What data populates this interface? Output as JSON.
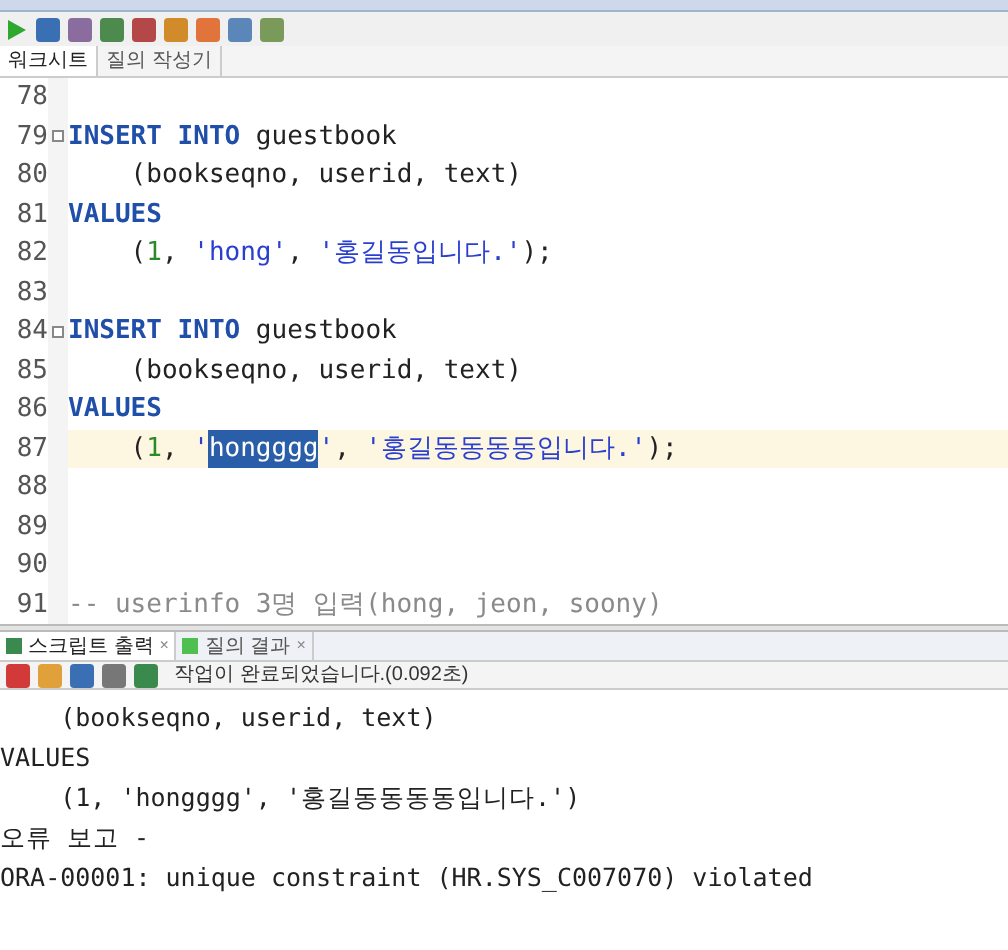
{
  "editor_tabs": [
    {
      "label": "워크시트",
      "selected": true
    },
    {
      "label": "질의 작성기",
      "selected": false
    }
  ],
  "editor": {
    "lines": [
      {
        "number": "78",
        "current": false
      },
      {
        "number": "79",
        "fold": true,
        "current": false,
        "tokens": [
          {
            "kind": "keyword",
            "text": "INSERT INTO"
          },
          {
            "kind": "plain",
            "text": " guestbook"
          }
        ]
      },
      {
        "number": "80",
        "current": false,
        "tokens": [
          {
            "kind": "plain",
            "text": "    (bookseqno, userid, text)"
          }
        ]
      },
      {
        "number": "81",
        "current": false,
        "tokens": [
          {
            "kind": "keyword",
            "text": "VALUES"
          }
        ]
      },
      {
        "number": "82",
        "current": false,
        "tokens": [
          {
            "kind": "plain",
            "text": "    ("
          },
          {
            "kind": "number",
            "text": "1"
          },
          {
            "kind": "plain",
            "text": ", "
          },
          {
            "kind": "string",
            "text": "'hong'"
          },
          {
            "kind": "plain",
            "text": ", "
          },
          {
            "kind": "string",
            "text": "'홍길동입니다.'"
          },
          {
            "kind": "plain",
            "text": ");"
          }
        ]
      },
      {
        "number": "83",
        "current": false
      },
      {
        "number": "84",
        "fold": true,
        "current": false,
        "tokens": [
          {
            "kind": "keyword",
            "text": "INSERT INTO"
          },
          {
            "kind": "plain",
            "text": " guestbook"
          }
        ]
      },
      {
        "number": "85",
        "current": false,
        "tokens": [
          {
            "kind": "plain",
            "text": "    (bookseqno, userid, text)"
          }
        ]
      },
      {
        "number": "86",
        "current": false,
        "tokens": [
          {
            "kind": "keyword",
            "text": "VALUES"
          }
        ]
      },
      {
        "number": "87",
        "current": true,
        "tokens": [
          {
            "kind": "plain",
            "text": "    ("
          },
          {
            "kind": "number",
            "text": "1"
          },
          {
            "kind": "plain",
            "text": ", "
          },
          {
            "kind": "string",
            "text": "'"
          },
          {
            "kind": "selection",
            "text": "hongggg"
          },
          {
            "kind": "string",
            "text": "'"
          },
          {
            "kind": "plain",
            "text": ", "
          },
          {
            "kind": "string",
            "text": "'홍길동동동동입니다.'"
          },
          {
            "kind": "plain",
            "text": ");"
          }
        ]
      },
      {
        "number": "88",
        "current": false
      },
      {
        "number": "89",
        "current": false
      },
      {
        "number": "90",
        "current": false
      },
      {
        "number": "91",
        "current": false,
        "tokens": [
          {
            "kind": "comment",
            "text": "-- userinfo 3명 입력(hong, jeon, soony)"
          }
        ]
      }
    ]
  },
  "output_tabs": [
    {
      "label": "스크립트 출력",
      "close": "×",
      "selected": true
    },
    {
      "label": "질의 결과",
      "close": "×",
      "selected": false
    }
  ],
  "output_status": "작업이 완료되었습니다.(0.092초)",
  "output_lines": [
    "    (bookseqno, userid, text)",
    "VALUES",
    "    (1, 'hongggg', '홍길동동동동입니다.')",
    "오류 보고 -",
    "ORA-00001: unique constraint (HR.SYS_C007070) violated"
  ]
}
